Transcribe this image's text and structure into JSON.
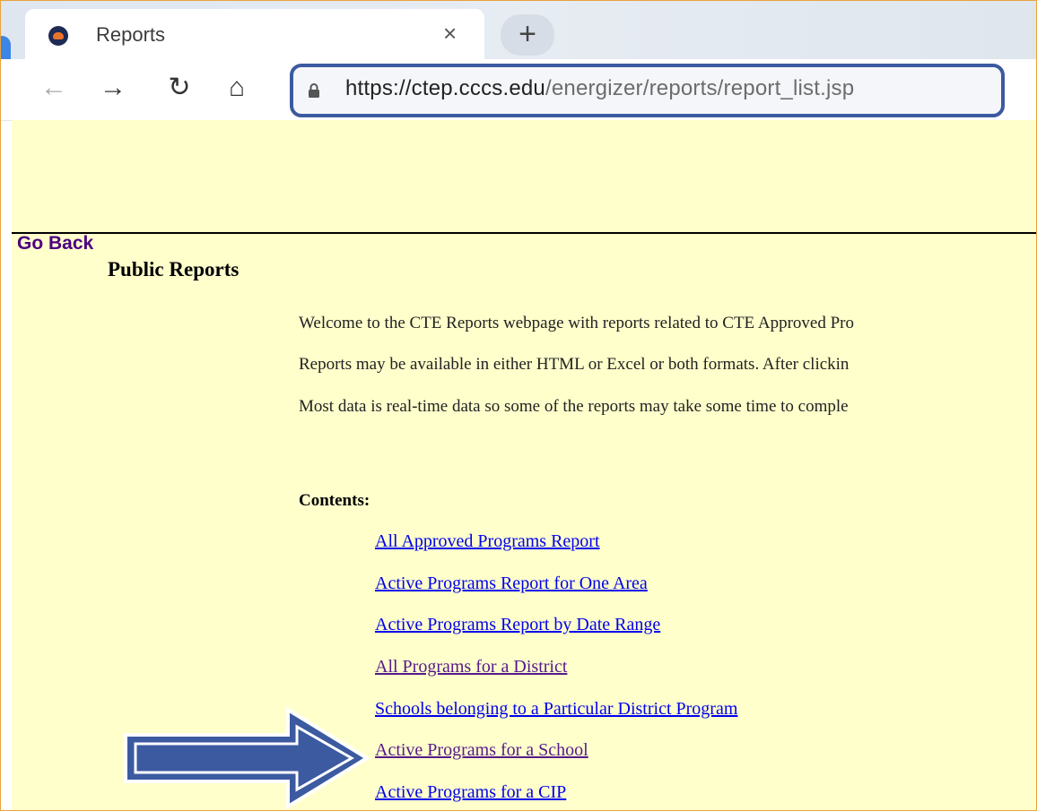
{
  "browser": {
    "tab": {
      "title": "Reports",
      "close_glyph": "×",
      "favicon": "site-favicon"
    },
    "new_tab_glyph": "+",
    "nav": {
      "back_glyph": "←",
      "forward_glyph": "→",
      "reload_glyph": "↻",
      "home_glyph": "⌂"
    },
    "address": {
      "host": "https://ctep.cccs.edu",
      "path": "/energizer/reports/report_list.jsp",
      "icon": "lock-icon"
    }
  },
  "page": {
    "go_back": "Go Back",
    "heading": "Public Reports",
    "intro": [
      "Welcome to the CTE Reports webpage with reports related to CTE Approved Pro",
      "Reports may be available in either HTML or Excel or both formats. After clickin",
      "Most data is real-time data so some of the reports may take some time to comple"
    ],
    "contents_heading": "Contents:",
    "links": [
      "All Approved Programs Report",
      "Active Programs Report for One Area",
      "Active Programs Report by Date Range",
      "All Programs for a District",
      "Schools belonging to a Particular District Program",
      "Active Programs for a School",
      "Active Programs for a CIP"
    ]
  },
  "colors": {
    "page_background": "#ffffcc",
    "link_unvisited": "#0000ee",
    "link_visited": "#551a8b",
    "annotation_arrow": "#3c5aa0",
    "annotation_frame": "#3c5aa0"
  }
}
